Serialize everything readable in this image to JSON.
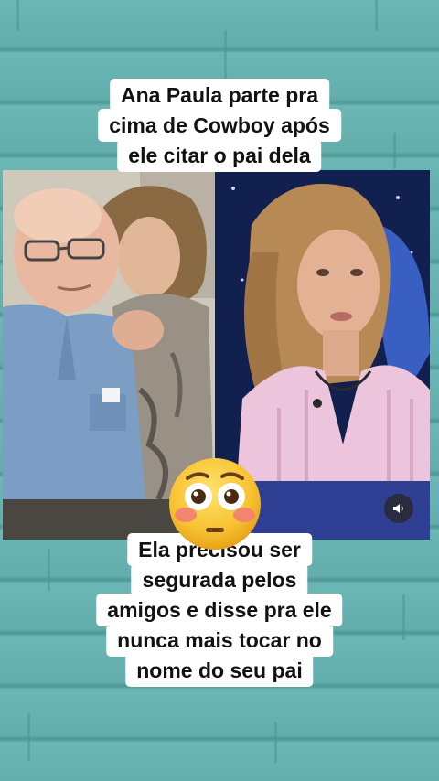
{
  "top_caption": {
    "lines": [
      "Ana Paula parte pra",
      "cima de Cowboy após",
      "ele citar o pai dela"
    ]
  },
  "bottom_caption": {
    "lines": [
      "Ela precisou ser",
      "segurada pelos",
      "amigos e disse pra ele",
      "nunca mais tocar no",
      "nome do seu pai"
    ]
  },
  "icons": {
    "sound": "speaker-icon",
    "reaction": "flushed-face-emoji"
  },
  "colors": {
    "background": "#67b2b0",
    "caption_bg": "#ffffff",
    "caption_text": "#111111"
  }
}
